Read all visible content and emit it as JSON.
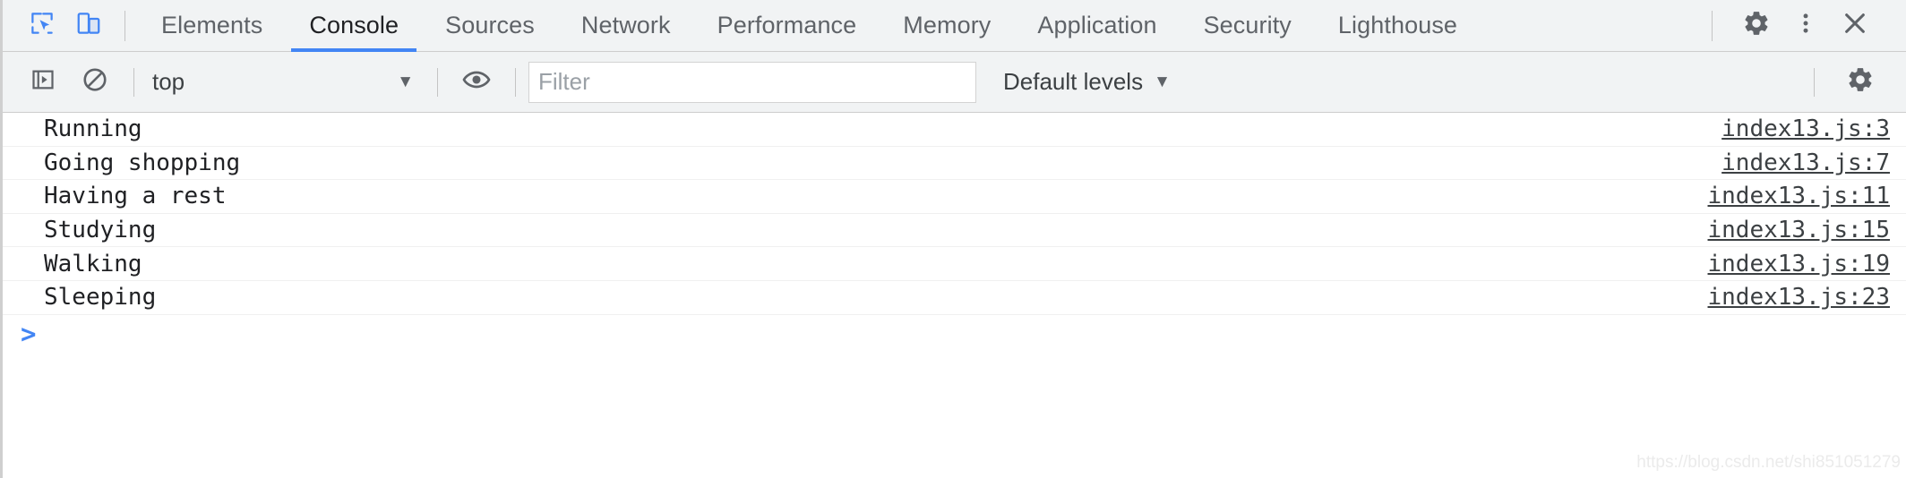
{
  "theme": {
    "bar_bg": "#f1f3f4",
    "accent": "#4285f4",
    "text_primary": "#202124",
    "text_secondary": "#5f6368",
    "panel_bg": "#ffffff",
    "border": "#cdcdcd",
    "row_border": "#f0f0f0"
  },
  "tabbar": {
    "inspect_icon": "inspect-element-icon",
    "device_icon": "device-toolbar-icon",
    "tabs": [
      {
        "label": "Elements",
        "active": false
      },
      {
        "label": "Console",
        "active": true
      },
      {
        "label": "Sources",
        "active": false
      },
      {
        "label": "Network",
        "active": false
      },
      {
        "label": "Performance",
        "active": false
      },
      {
        "label": "Memory",
        "active": false
      },
      {
        "label": "Application",
        "active": false
      },
      {
        "label": "Security",
        "active": false
      },
      {
        "label": "Lighthouse",
        "active": false
      }
    ],
    "settings_icon": "gear-icon",
    "more_icon": "kebab-menu-icon",
    "close_icon": "close-icon"
  },
  "filterbar": {
    "sidebar_toggle_icon": "show-console-sidebar-icon",
    "clear_icon": "clear-console-icon",
    "context": {
      "value": "top",
      "caret": "▼"
    },
    "live_expression_icon": "eye-icon",
    "filter": {
      "value": "",
      "placeholder": "Filter"
    },
    "levels": {
      "label": "Default levels",
      "caret": "▼"
    },
    "settings_icon": "gear-icon"
  },
  "console": {
    "messages": [
      {
        "text": "Running",
        "source": "index13.js:3"
      },
      {
        "text": "Going shopping",
        "source": "index13.js:7"
      },
      {
        "text": "Having a rest",
        "source": "index13.js:11"
      },
      {
        "text": "Studying",
        "source": "index13.js:15"
      },
      {
        "text": "Walking",
        "source": "index13.js:19"
      },
      {
        "text": "Sleeping",
        "source": "index13.js:23"
      }
    ],
    "prompt": {
      "caret": ">",
      "value": "",
      "placeholder": ""
    }
  },
  "watermark": {
    "text": "https://blog.csdn.net/shi851051279"
  }
}
